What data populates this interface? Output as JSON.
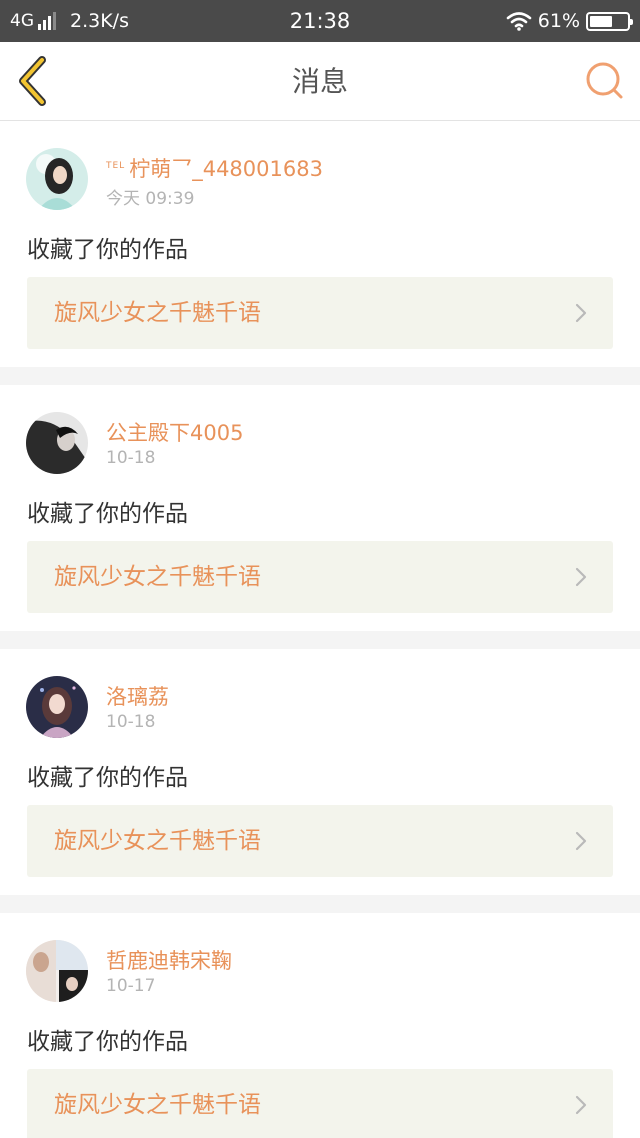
{
  "status_bar": {
    "network": "4G",
    "speed": "2.3K/s",
    "time": "21:38",
    "battery": "61%",
    "battery_level": 0.61,
    "signal_icon": "signal-bars-icon",
    "wifi_icon": "wifi-icon"
  },
  "nav": {
    "title": "消息",
    "back_icon": "chevron-left-icon",
    "search_icon": "search-icon",
    "accent_color": "#e8925a"
  },
  "messages": [
    {
      "prefix": "TEL",
      "user": "柠萌乛_448001683",
      "time": "今天 09:39",
      "action": "收藏了你的作品",
      "work": "旋风少女之千魅千语"
    },
    {
      "prefix": "",
      "user": "公主殿下4005",
      "time": "10-18",
      "action": "收藏了你的作品",
      "work": "旋风少女之千魅千语"
    },
    {
      "prefix": "",
      "user": "洛璃荔",
      "time": "10-18",
      "action": "收藏了你的作品",
      "work": "旋风少女之千魅千语"
    },
    {
      "prefix": "",
      "user": "哲鹿迪韩宋鞠",
      "time": "10-17",
      "action": "收藏了你的作品",
      "work": "旋风少女之千魅千语"
    }
  ]
}
